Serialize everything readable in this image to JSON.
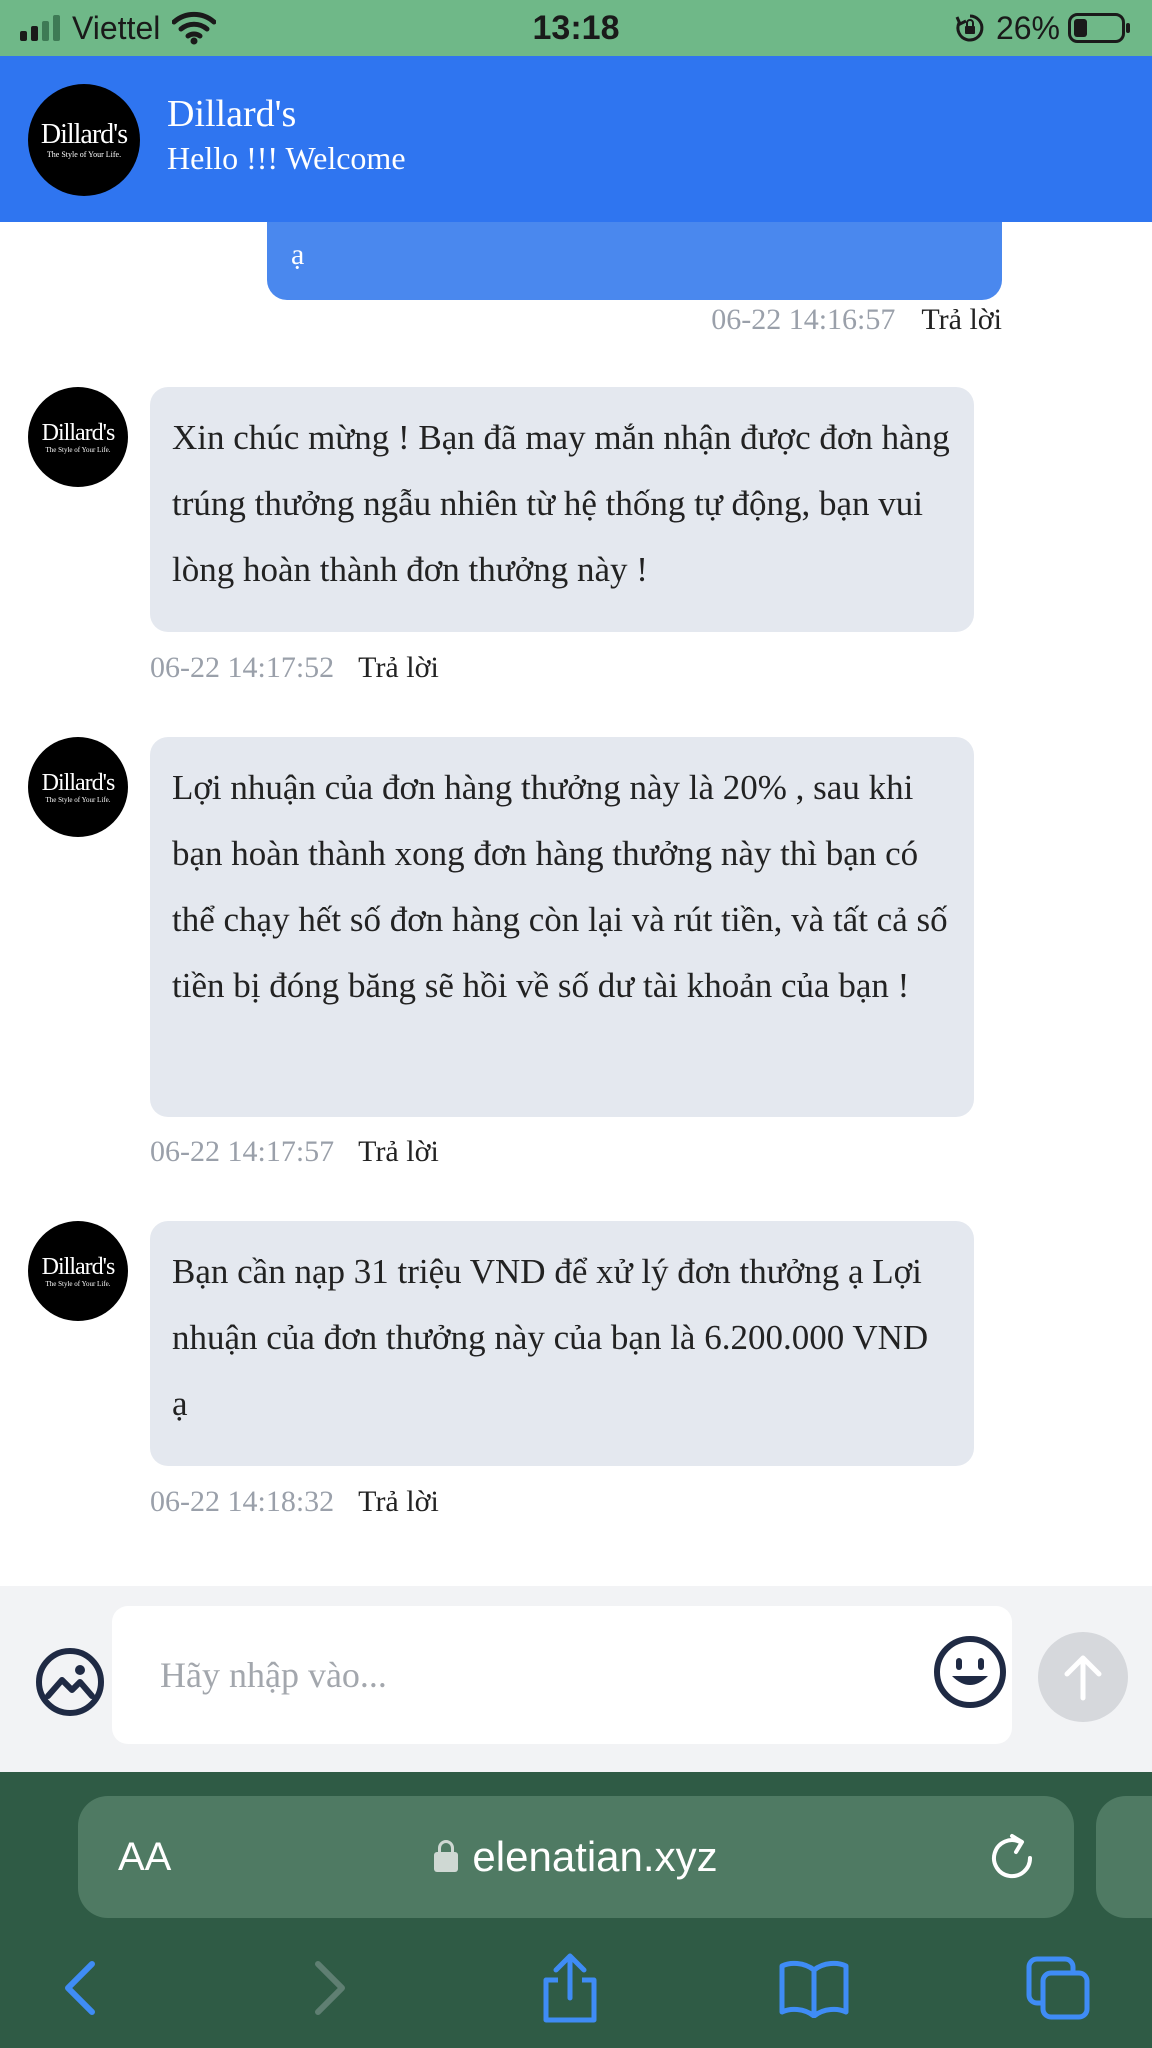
{
  "status_bar": {
    "carrier": "Viettel",
    "time": "13:18",
    "battery": "26%"
  },
  "header": {
    "logo_text": "Dillard's",
    "logo_tagline": "The Style of Your Life.",
    "title": "Dillard's",
    "subtitle": "Hello !!! Welcome"
  },
  "chat": {
    "sent_fragment": "ạ",
    "sent_timestamp": "06-22 14:16:57",
    "reply_label": "Trả lời",
    "messages": [
      {
        "text": "Xin chúc mừng ! Bạn đã may mắn nhận được đơn hàng trúng thưởng ngẫu nhiên từ hệ thống tự động, bạn vui lòng hoàn thành đơn thưởng này !",
        "timestamp": "06-22 14:17:52"
      },
      {
        "text": "Lợi nhuận của đơn hàng thưởng này là 20% , sau khi bạn hoàn thành xong đơn hàng thưởng này thì bạn có thể chạy hết số đơn hàng còn lại và rút tiền, và tất cả số tiền bị đóng băng sẽ hồi về số dư tài khoản của bạn !",
        "timestamp": "06-22 14:17:57"
      },
      {
        "text": "Bạn cần nạp 31 triệu VND để xử lý đơn thưởng ạ Lợi nhuận của đơn thưởng này của bạn là 6.200.000 VND ạ",
        "timestamp": "06-22 14:18:32"
      }
    ]
  },
  "composer": {
    "placeholder": "Hãy nhập vào..."
  },
  "browser": {
    "text_size_label": "AA",
    "url": "elenatian.xyz"
  },
  "icons": {
    "gallery": "image-icon",
    "emoji": "smile-icon",
    "send": "arrow-up-icon",
    "back": "chevron-left-icon",
    "forward": "chevron-right-icon",
    "share": "share-icon",
    "bookmarks": "book-icon",
    "tabs": "tabs-icon",
    "reload": "reload-icon"
  },
  "colors": {
    "header": "#2f75f0",
    "status_bar": "#6fb888",
    "browser_bar": "#2f5b45",
    "received_bubble": "#e4e8ef",
    "sent_bubble": "#4a88ee"
  }
}
